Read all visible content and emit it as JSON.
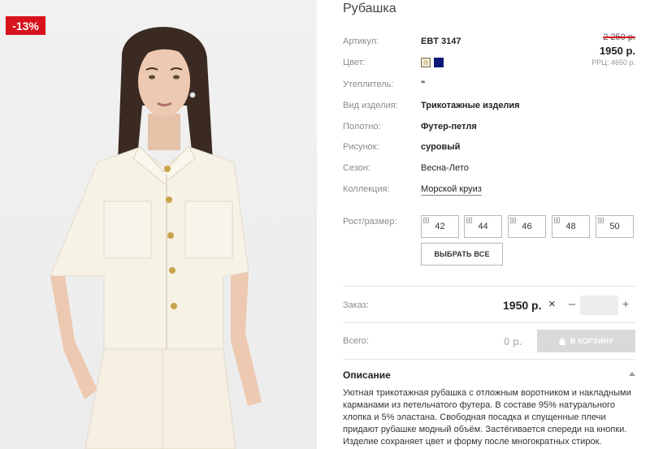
{
  "badge": {
    "discount": "-13%"
  },
  "product": {
    "title": "Рубашка",
    "attributes": [
      {
        "label": "Артикул:",
        "value": "EBT 3147"
      },
      {
        "label": "Цвет:",
        "value": ""
      },
      {
        "label": "Утеплитель:",
        "value": "\""
      },
      {
        "label": "Вид изделия:",
        "value": "Трикотажные изделия"
      },
      {
        "label": "Полотно:",
        "value": "Футер-петля"
      },
      {
        "label": "Рисунок:",
        "value": "суровый"
      },
      {
        "label": "Сезон:",
        "value": "Весна-Лето"
      },
      {
        "label": "Коллекция:",
        "value": "Морской круиз"
      }
    ],
    "colors": [
      {
        "name": "beige",
        "hex": "#d9cda7"
      },
      {
        "name": "navy",
        "hex": "#0d1a7a"
      }
    ]
  },
  "pricing": {
    "old_price": "2 250 р.",
    "price": "1950 р.",
    "rrp": "РРЦ: 4650 р."
  },
  "sizes": {
    "label": "Рост/размер:",
    "options": [
      "42",
      "44",
      "46",
      "48",
      "50"
    ],
    "select_all": "ВЫБРАТЬ ВСЕ"
  },
  "order": {
    "label": "Заказ:",
    "price": "1950 р.",
    "times": "×",
    "minus": "–",
    "plus": "+",
    "quantity": ""
  },
  "total": {
    "label": "Всего:",
    "value": "0 р.",
    "cart_button": "В КОРЗИНУ"
  },
  "description": {
    "title": "Описание",
    "text": "Уютная трикотажная рубашка с отложным воротником и накладными карманами из петельчатого футера. В составе 95% натурального хлопка и 5% эластана. Свободная посадка и спущенные плечи придают рубашке модный объём. Застёгивается спереди на кнопки. Изделие сохраняет цвет и форму после многократных стирок."
  },
  "icons": [
    "checkbox-icon",
    "bag-icon",
    "caret-up-icon"
  ]
}
